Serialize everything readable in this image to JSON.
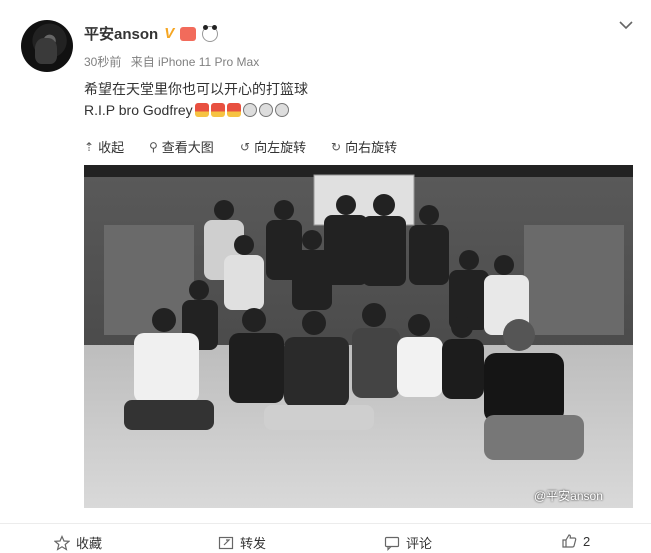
{
  "post": {
    "username": "平安anson",
    "verified_mark": "V",
    "time": "30秒前",
    "source": "来自 iPhone 11 Pro Max",
    "text_line1": "希望在天堂里你也可以开心的打篮球",
    "text_line2": "R.I.P bro Godfrey"
  },
  "toolbar": {
    "collapse": "收起",
    "view_large": "查看大图",
    "rotate_left": "向左旋转",
    "rotate_right": "向右旋转"
  },
  "photo": {
    "watermark": "@平安anson"
  },
  "actions": {
    "favorite": "收藏",
    "repost": "转发",
    "comment": "评论",
    "like_count": "2"
  },
  "colors": {
    "verified": "#f5a623",
    "meta_text": "#808080",
    "border": "#ececec"
  },
  "icons": [
    "chevron-down-icon",
    "collapse-icon",
    "magnify-icon",
    "rotate-left-icon",
    "rotate-right-icon",
    "star-icon",
    "repost-icon",
    "comment-icon",
    "thumb-up-icon"
  ]
}
